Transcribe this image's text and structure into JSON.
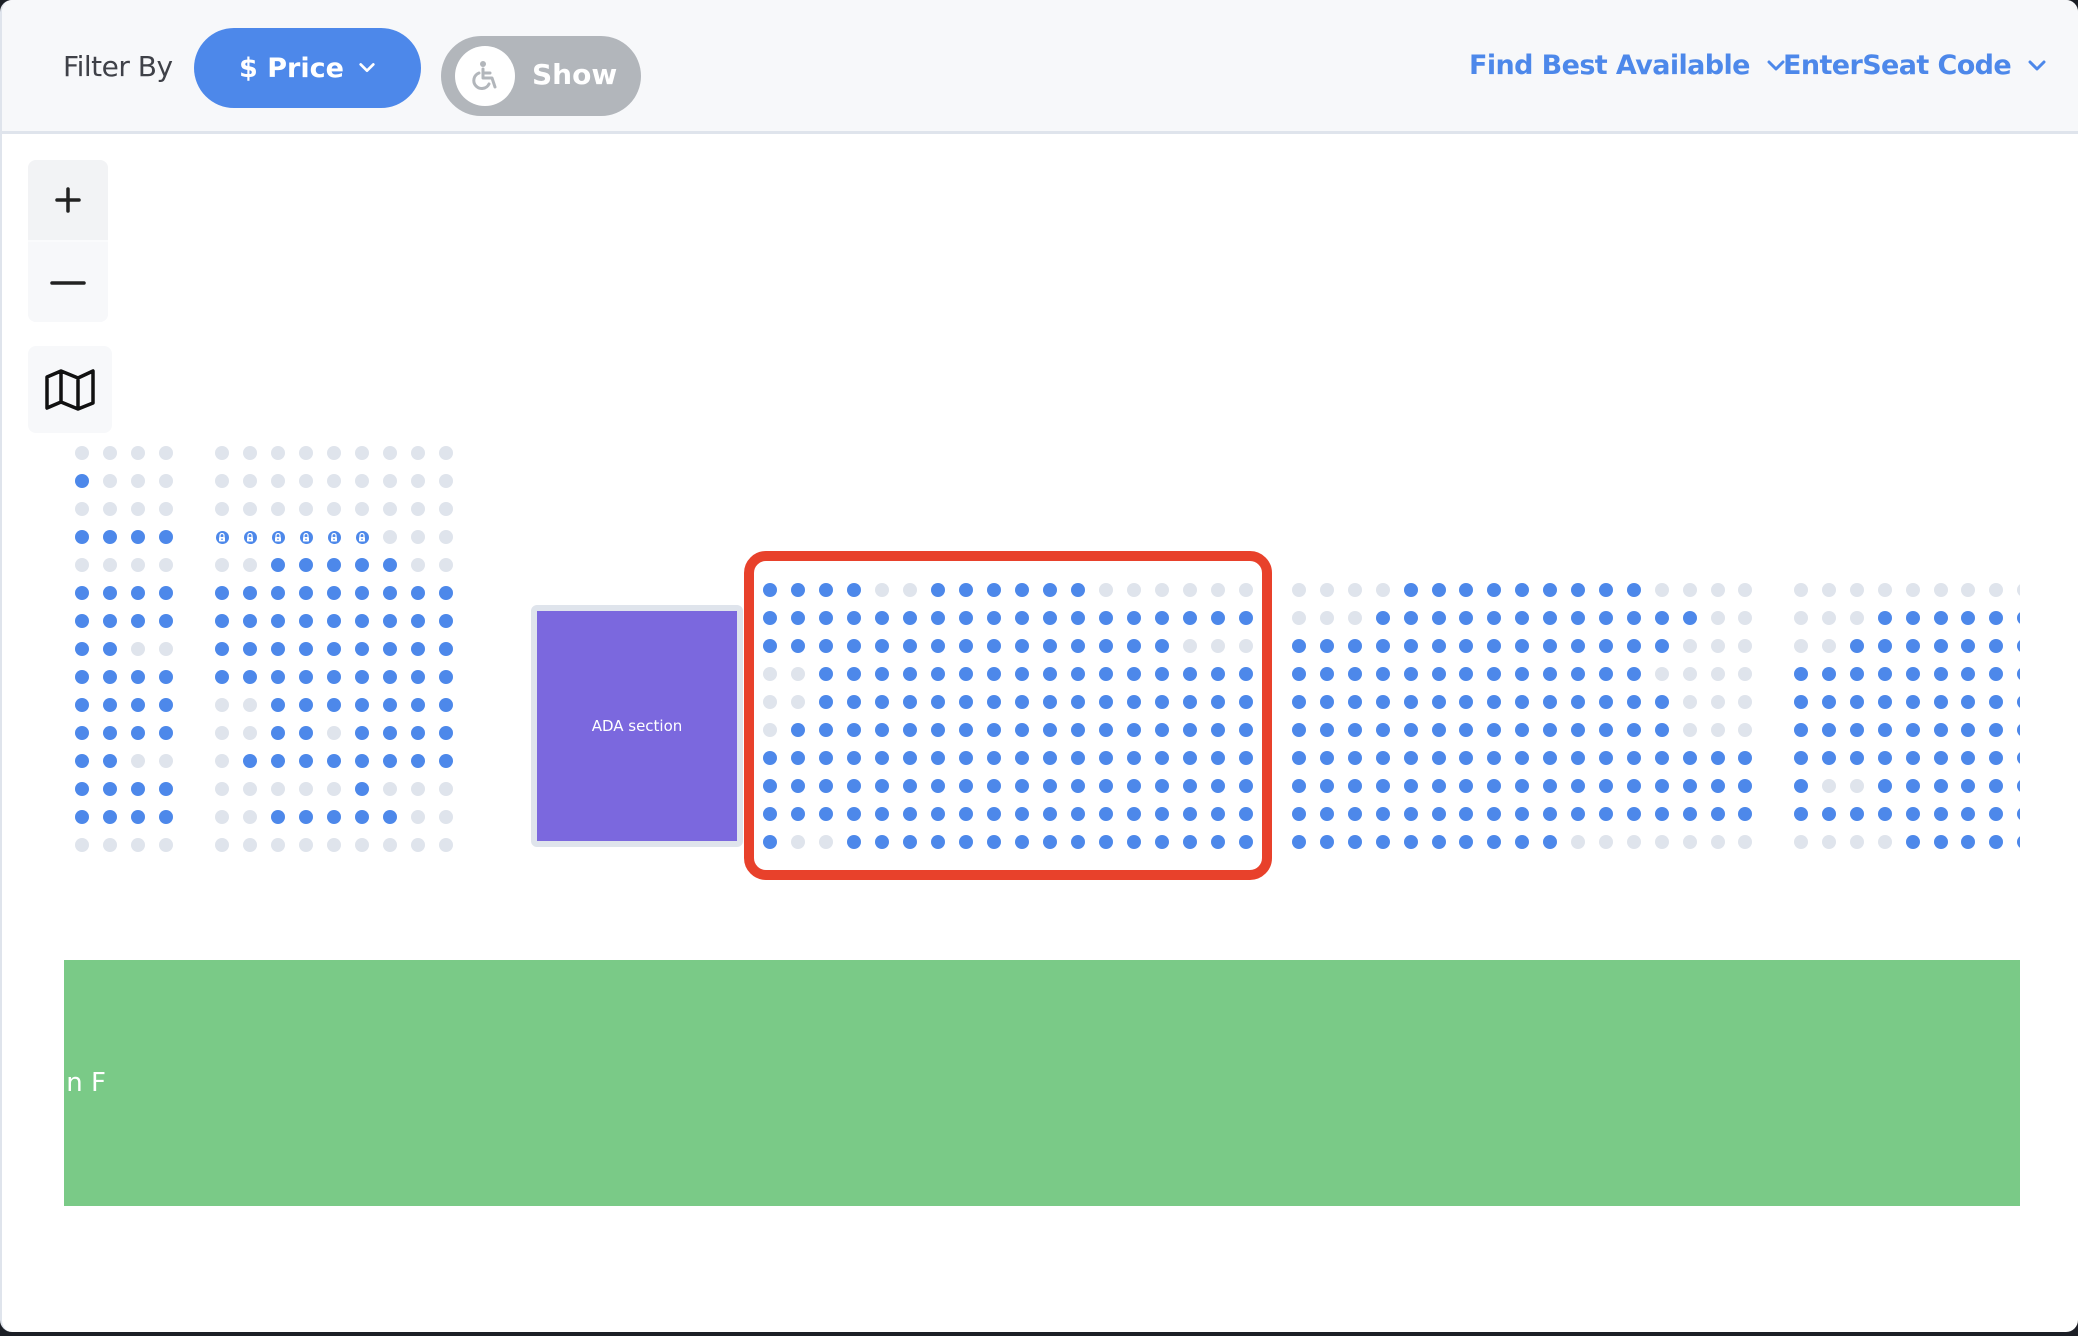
{
  "header": {
    "filter_label": "Filter By",
    "price_button": {
      "prefix": "$",
      "label": "Price",
      "icon": "chevron-down-icon"
    },
    "ada_toggle": {
      "label": "Show",
      "icon": "wheelchair-icon",
      "on": false
    },
    "find_best": {
      "label": "Find Best Available",
      "icon": "chevron-down-icon"
    },
    "seat_code": {
      "label": "EnterSeat Code",
      "icon": "chevron-down-icon"
    }
  },
  "map_controls": {
    "zoom_in": "plus-icon",
    "zoom_out": "minus-icon",
    "overview": "map-icon"
  },
  "colors": {
    "available": "#4d88ea",
    "unavailable": "#dfe4ec",
    "ada": "#7b68de",
    "highlight": "#e8412b",
    "stage": "#7aca87"
  },
  "legend_key": {
    "1": "available",
    "0": "unavailable",
    "L": "locked"
  },
  "seat_blocks": [
    {
      "id": "block-a",
      "rows": [
        "0000",
        "1000",
        "0000",
        "1111",
        "0000",
        "1111",
        "1111",
        "1100",
        "1111",
        "1111",
        "1111",
        "1100",
        "1111",
        "1111",
        "0000"
      ]
    },
    {
      "id": "block-b",
      "rows": [
        "000000000",
        "000000000",
        "000000000",
        "LLLLLL000",
        "001111100",
        "111111111",
        "111111111",
        "111111111",
        "111111111",
        "001111111",
        "001101111",
        "011111111",
        "000001000",
        "001111100",
        "000000000"
      ]
    },
    {
      "id": "block-c",
      "highlighted": true,
      "rows": [
        "111100111111000000",
        "111111111111111111",
        "111111111111111000",
        "001111111111111111",
        "001111111111111111",
        "011111111111111111",
        "111111111111111111",
        "111111111111111111",
        "111111111111111111",
        "100111111111111111"
      ]
    },
    {
      "id": "block-d",
      "rows": [
        "00001111111110000",
        "00011111111111100",
        "11111111111111000",
        "11111111111110000",
        "11111111111111000",
        "11111111111111000",
        "11111111111111111",
        "11111111111111111",
        "11111111111111111",
        "11111111110000000"
      ]
    },
    {
      "id": "block-e",
      "rows": [
        "000000000",
        "000111111",
        "001111111",
        "111111111",
        "111111111",
        "111111111",
        "111111111",
        "100111111",
        "111111111",
        "000011111"
      ]
    }
  ],
  "ada_section": {
    "label": "ADA section"
  },
  "stage": {
    "label": "n F"
  }
}
